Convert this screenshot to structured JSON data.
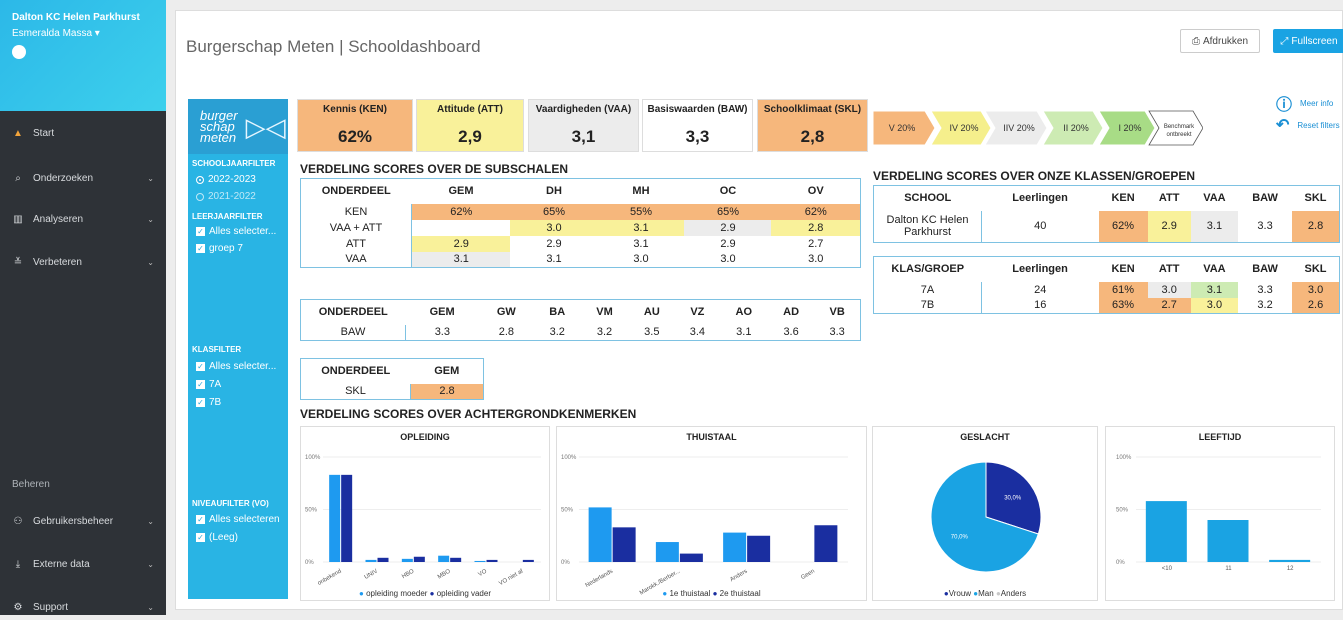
{
  "sidebar": {
    "school": "Dalton KC Helen Parkhurst",
    "user": "Esmeralda Massa",
    "items": [
      {
        "label": "Start",
        "icon": "flag-icon"
      },
      {
        "label": "Onderzoeken",
        "icon": "search-icon"
      },
      {
        "label": "Analyseren",
        "icon": "chart-icon"
      },
      {
        "label": "Verbeteren",
        "icon": "improve-icon"
      },
      {
        "label": "Beheren",
        "icon": ""
      },
      {
        "label": "Gebruikersbeheer",
        "icon": "users-icon"
      },
      {
        "label": "Externe data",
        "icon": "download-icon"
      },
      {
        "label": "Support",
        "icon": "support-icon"
      }
    ]
  },
  "header": {
    "title": "Burgerschap Meten | Schooldashboard",
    "print_label": "Afdrukken",
    "fullscreen_label": "Fullscreen",
    "meer_info": "Meer info",
    "reset_filters": "Reset filters"
  },
  "logo": {
    "text": "burger schap meten"
  },
  "filters": {
    "schooljaar": {
      "title": "SCHOOLJAARFILTER",
      "options": [
        "2022-2023",
        "2021-2022"
      ],
      "selected": "2022-2023"
    },
    "leerjaar": {
      "title": "LEERJAARFILTER",
      "options": [
        "Alles selecter...",
        "groep 7"
      ]
    },
    "klas": {
      "title": "KLASFILTER",
      "options": [
        "Alles selecter...",
        "7A",
        "7B"
      ]
    },
    "niveau": {
      "title": "NIVEAUFILTER (VO)",
      "options": [
        "Alles selecteren",
        "(Leeg)"
      ]
    }
  },
  "kpis": [
    {
      "label": "Kennis (KEN)",
      "value": "62%",
      "color": "#f6b77c"
    },
    {
      "label": "Attitude (ATT)",
      "value": "2,9",
      "color": "#f9f19a"
    },
    {
      "label": "Vaardigheden (VAA)",
      "value": "3,1",
      "color": "#ececec"
    },
    {
      "label": "Basiswaarden (BAW)",
      "value": "3,3",
      "color": "#ffffff"
    },
    {
      "label": "Schoolklimaat (SKL)",
      "value": "2,8",
      "color": "#f6b77c"
    }
  ],
  "benchmark": [
    {
      "label": "V 20%",
      "color": "#f6b77c"
    },
    {
      "label": "IV 20%",
      "color": "#f5ef8c"
    },
    {
      "label": "IIV 20%",
      "color": "#ececec"
    },
    {
      "label": "II 20%",
      "color": "#cdebb3"
    },
    {
      "label": "I 20%",
      "color": "#a8dc86"
    },
    {
      "label": "Benchmark ontbreekt",
      "color": "#ffffff"
    }
  ],
  "sections": {
    "subschalen": "VERDELING SCORES OVER DE SUBSCHALEN",
    "klassen": "VERDELING SCORES OVER ONZE KLASSEN/GROEPEN",
    "achtergrond": "VERDELING SCORES OVER ACHTERGRONDKENMERKEN"
  },
  "table1": {
    "headers": [
      "ONDERDEEL",
      "GEM",
      "DH",
      "MH",
      "OC",
      "OV"
    ],
    "rows": [
      {
        "cells": [
          "KEN",
          "62%",
          "65%",
          "55%",
          "65%",
          "62%"
        ],
        "colors": [
          "",
          "#f6b77c",
          "#f6b77c",
          "#f6b77c",
          "#f6b77c",
          "#f6b77c"
        ]
      },
      {
        "cells": [
          "VAA + ATT",
          "",
          "3.0",
          "3.1",
          "2.9",
          "2.8"
        ],
        "colors": [
          "",
          "",
          "#f9f19a",
          "#f9f19a",
          "#ececec",
          "#f9f19a"
        ]
      },
      {
        "cells": [
          "ATT",
          "2.9",
          "2.9",
          "3.1",
          "2.9",
          "2.7"
        ],
        "colors": [
          "",
          "#f9f19a",
          "",
          "",
          "",
          ""
        ]
      },
      {
        "cells": [
          "VAA",
          "3.1",
          "3.1",
          "3.0",
          "3.0",
          "3.0"
        ],
        "colors": [
          "",
          "#ececec",
          "",
          "",
          "",
          ""
        ]
      }
    ]
  },
  "table2": {
    "headers": [
      "ONDERDEEL",
      "GEM",
      "GW",
      "BA",
      "VM",
      "AU",
      "VZ",
      "AO",
      "AD",
      "VB"
    ],
    "row": [
      "BAW",
      "3.3",
      "2.8",
      "3.2",
      "3.2",
      "3.5",
      "3.4",
      "3.1",
      "3.6",
      "3.3"
    ]
  },
  "table3": {
    "headers": [
      "ONDERDEEL",
      "GEM"
    ],
    "row": [
      "SKL",
      "2.8"
    ],
    "color": "#f6b77c"
  },
  "table4": {
    "headers": [
      "SCHOOL",
      "Leerlingen",
      "KEN",
      "ATT",
      "VAA",
      "BAW",
      "SKL"
    ],
    "row": [
      "Dalton KC Helen Parkhurst",
      "40",
      "62%",
      "2.9",
      "3.1",
      "3.3",
      "2.8"
    ],
    "colors": [
      "",
      "",
      "#f6b77c",
      "#f9f19a",
      "#ececec",
      "",
      "#f6b77c"
    ]
  },
  "table5": {
    "headers": [
      "KLAS/GROEP",
      "Leerlingen",
      "KEN",
      "ATT",
      "VAA",
      "BAW",
      "SKL"
    ],
    "rows": [
      {
        "cells": [
          "7A",
          "24",
          "61%",
          "3.0",
          "3.1",
          "3.3",
          "3.0"
        ],
        "colors": [
          "",
          "",
          "#f6b77c",
          "#ececec",
          "#cdebb3",
          "",
          "#f6b77c"
        ]
      },
      {
        "cells": [
          "7B",
          "16",
          "63%",
          "2.7",
          "3.0",
          "3.2",
          "2.6"
        ],
        "colors": [
          "",
          "",
          "#f6b77c",
          "#f6b77c",
          "#f9f19a",
          "",
          "#f6b77c"
        ]
      }
    ]
  },
  "chart_data": [
    {
      "type": "bar",
      "title": "OPLEIDING",
      "categories": [
        "onbekend",
        "UNIV",
        "HBO",
        "MBO",
        "VO",
        "VO niet af"
      ],
      "ylim": [
        0,
        100
      ],
      "yticks": [
        "100%",
        "50%",
        "0%"
      ],
      "series": [
        {
          "name": "opleiding moeder",
          "color": "#1e9af0",
          "values": [
            83,
            2,
            3,
            6,
            1,
            0
          ]
        },
        {
          "name": "opleiding vader",
          "color": "#1a2ea0",
          "values": [
            83,
            4,
            5,
            4,
            2,
            2
          ]
        }
      ]
    },
    {
      "type": "bar",
      "title": "THUISTAAL",
      "categories": [
        "Nederlands",
        "Marokk./Berber...",
        "Anders",
        "Geen"
      ],
      "ylim": [
        0,
        100
      ],
      "yticks": [
        "100%",
        "50%",
        "0%"
      ],
      "series": [
        {
          "name": "1e thuistaal",
          "color": "#1e9af0",
          "values": [
            52,
            19,
            28,
            0
          ]
        },
        {
          "name": "2e thuistaal",
          "color": "#1a2ea0",
          "values": [
            33,
            8,
            25,
            35
          ]
        }
      ]
    },
    {
      "type": "pie",
      "title": "GESLACHT",
      "slices": [
        {
          "name": "Vrouw",
          "color": "#1a2ea0",
          "value": 30,
          "label": "30,0%"
        },
        {
          "name": "Man",
          "color": "#1aa3e3",
          "value": 70,
          "label": "70,0%"
        },
        {
          "name": "Anders",
          "color": "#c8c8c8",
          "value": 0,
          "label": ""
        }
      ]
    },
    {
      "type": "bar",
      "title": "LEEFTIJD",
      "categories": [
        "<10",
        "11",
        "12"
      ],
      "ylim": [
        0,
        100
      ],
      "yticks": [
        "100%",
        "50%",
        "0%"
      ],
      "series": [
        {
          "name": "",
          "color": "#1aa3e3",
          "values": [
            58,
            40,
            2
          ]
        }
      ]
    }
  ]
}
